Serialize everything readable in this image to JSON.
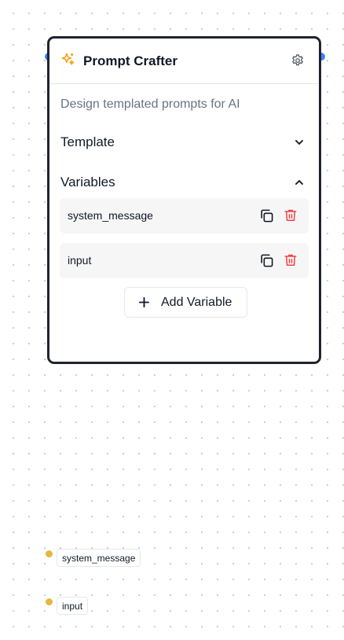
{
  "node": {
    "title": "Prompt Crafter",
    "description": "Design templated prompts for AI",
    "sections": {
      "template_label": "Template",
      "variables_label": "Variables"
    },
    "variables": [
      {
        "name": "system_message"
      },
      {
        "name": "input"
      }
    ],
    "add_variable_label": "Add Variable",
    "icons": {
      "title": "sparkle-icon",
      "settings": "gear-icon",
      "template_toggle": "chevron-down-icon",
      "variables_toggle": "chevron-up-icon",
      "copy": "copy-icon",
      "delete": "trash-icon",
      "add": "plus-icon"
    }
  },
  "output_handles": [
    {
      "label": "system_message"
    },
    {
      "label": "input"
    }
  ],
  "colors": {
    "accent_handle": "#3b82f6",
    "output_handle": "#e6b83f",
    "sparkle": "#f59e0b",
    "delete": "#ef4444",
    "node_border": "#1f2430"
  }
}
